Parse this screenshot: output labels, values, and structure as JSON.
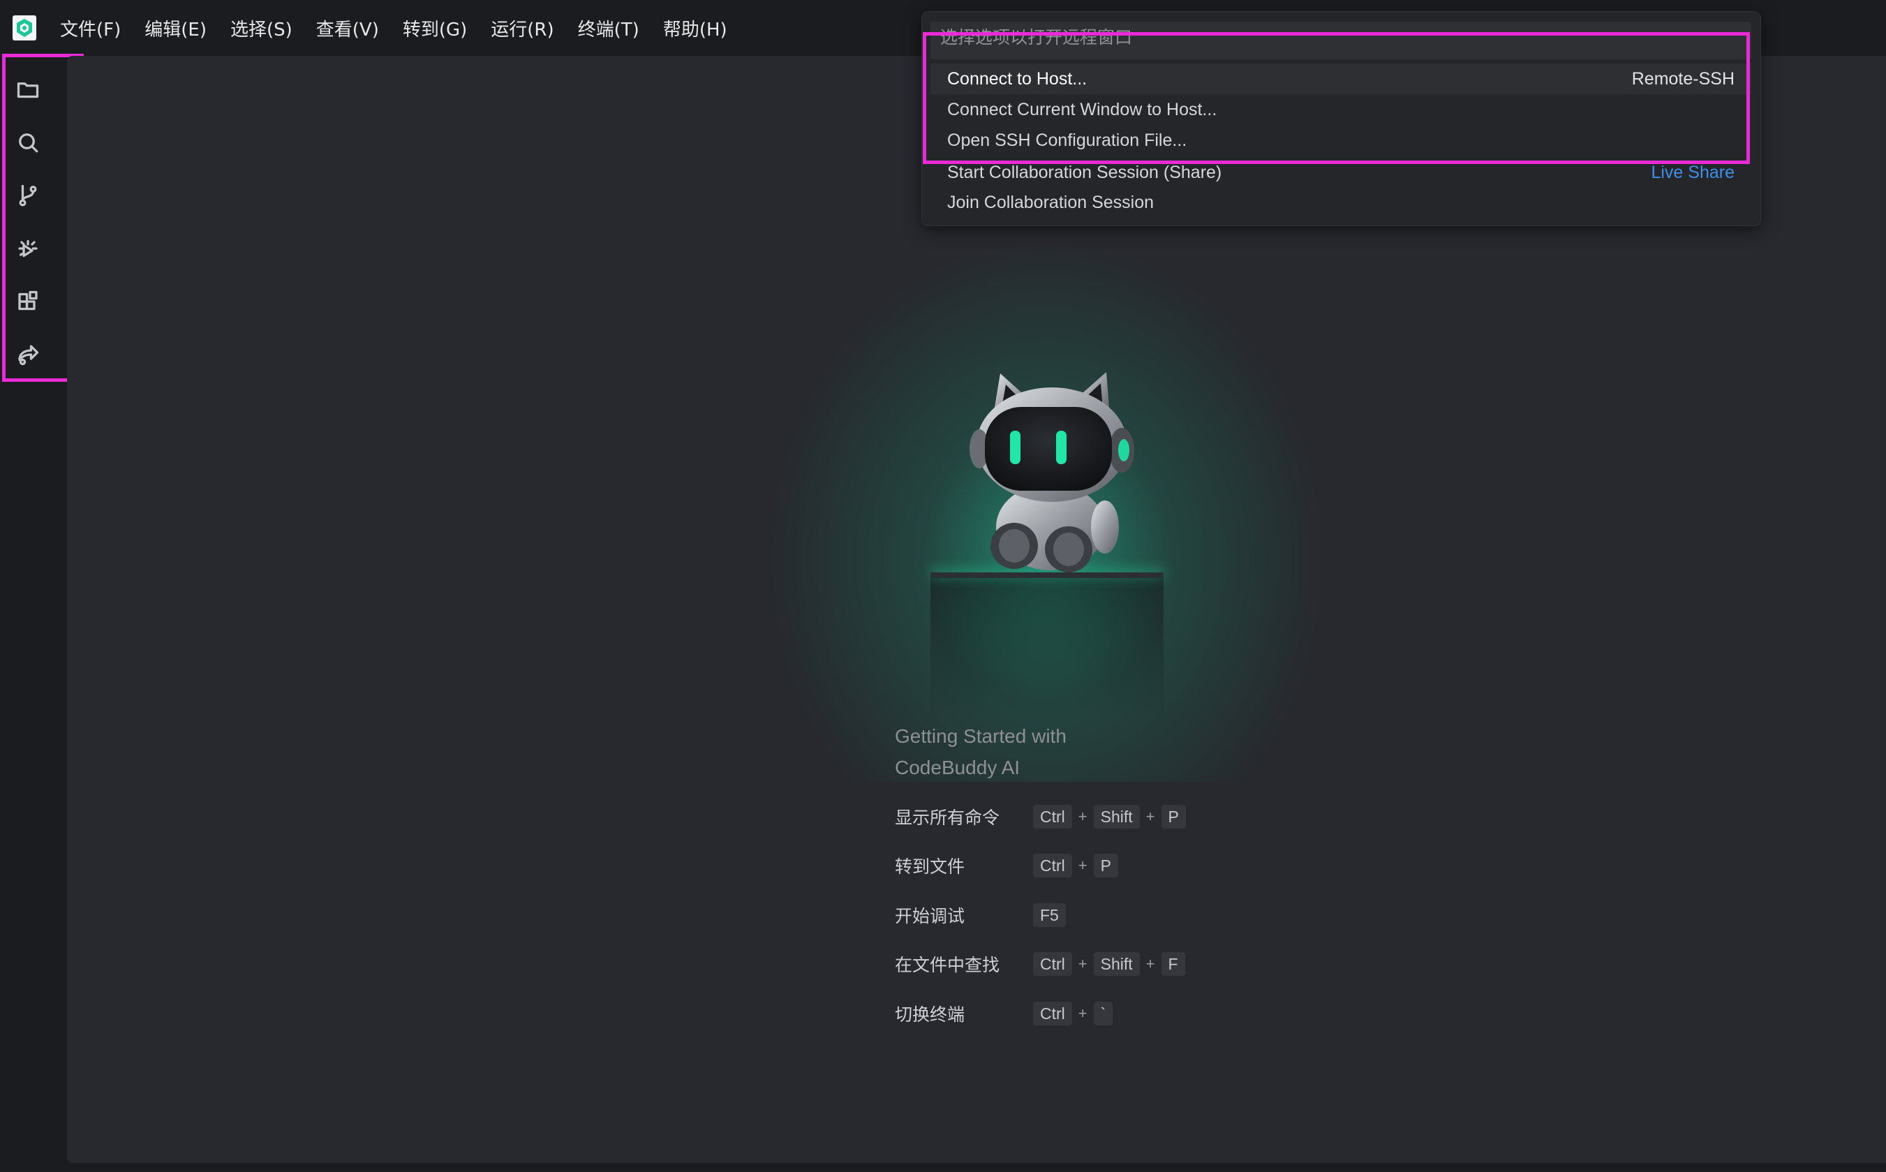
{
  "menu": {
    "items": [
      "文件(F)",
      "编辑(E)",
      "选择(S)",
      "查看(V)",
      "转到(G)",
      "运行(R)",
      "终端(T)",
      "帮助(H)"
    ]
  },
  "activity_bar": {
    "icons": [
      "folder-icon",
      "search-icon",
      "source-control-icon",
      "debug-icon",
      "extensions-icon",
      "remote-share-icon"
    ]
  },
  "quick_pick": {
    "placeholder": "选择选项以打开远程窗口",
    "items": [
      {
        "label": "Connect to Host...",
        "detail": "Remote-SSH"
      },
      {
        "label": "Connect Current Window to Host...",
        "detail": ""
      },
      {
        "label": "Open SSH Configuration File...",
        "detail": ""
      },
      {
        "label": "Start Collaboration Session (Share)",
        "detail": "Live Share"
      },
      {
        "label": "Join Collaboration Session",
        "detail": ""
      }
    ]
  },
  "welcome": {
    "title": "Getting Started with\nCodeBuddy AI",
    "shortcuts": [
      {
        "label": "显示所有命令",
        "keys": [
          "Ctrl",
          "Shift",
          "P"
        ]
      },
      {
        "label": "转到文件",
        "keys": [
          "Ctrl",
          "P"
        ]
      },
      {
        "label": "开始调试",
        "keys": [
          "F5"
        ]
      },
      {
        "label": "在文件中查找",
        "keys": [
          "Ctrl",
          "Shift",
          "F"
        ]
      },
      {
        "label": "切换终端",
        "keys": [
          "Ctrl",
          "`"
        ]
      }
    ],
    "plus_sign": "+"
  },
  "colors": {
    "highlight": "#ea2ad6",
    "accent": "#1fd8a0",
    "link": "#3d8fe8"
  }
}
